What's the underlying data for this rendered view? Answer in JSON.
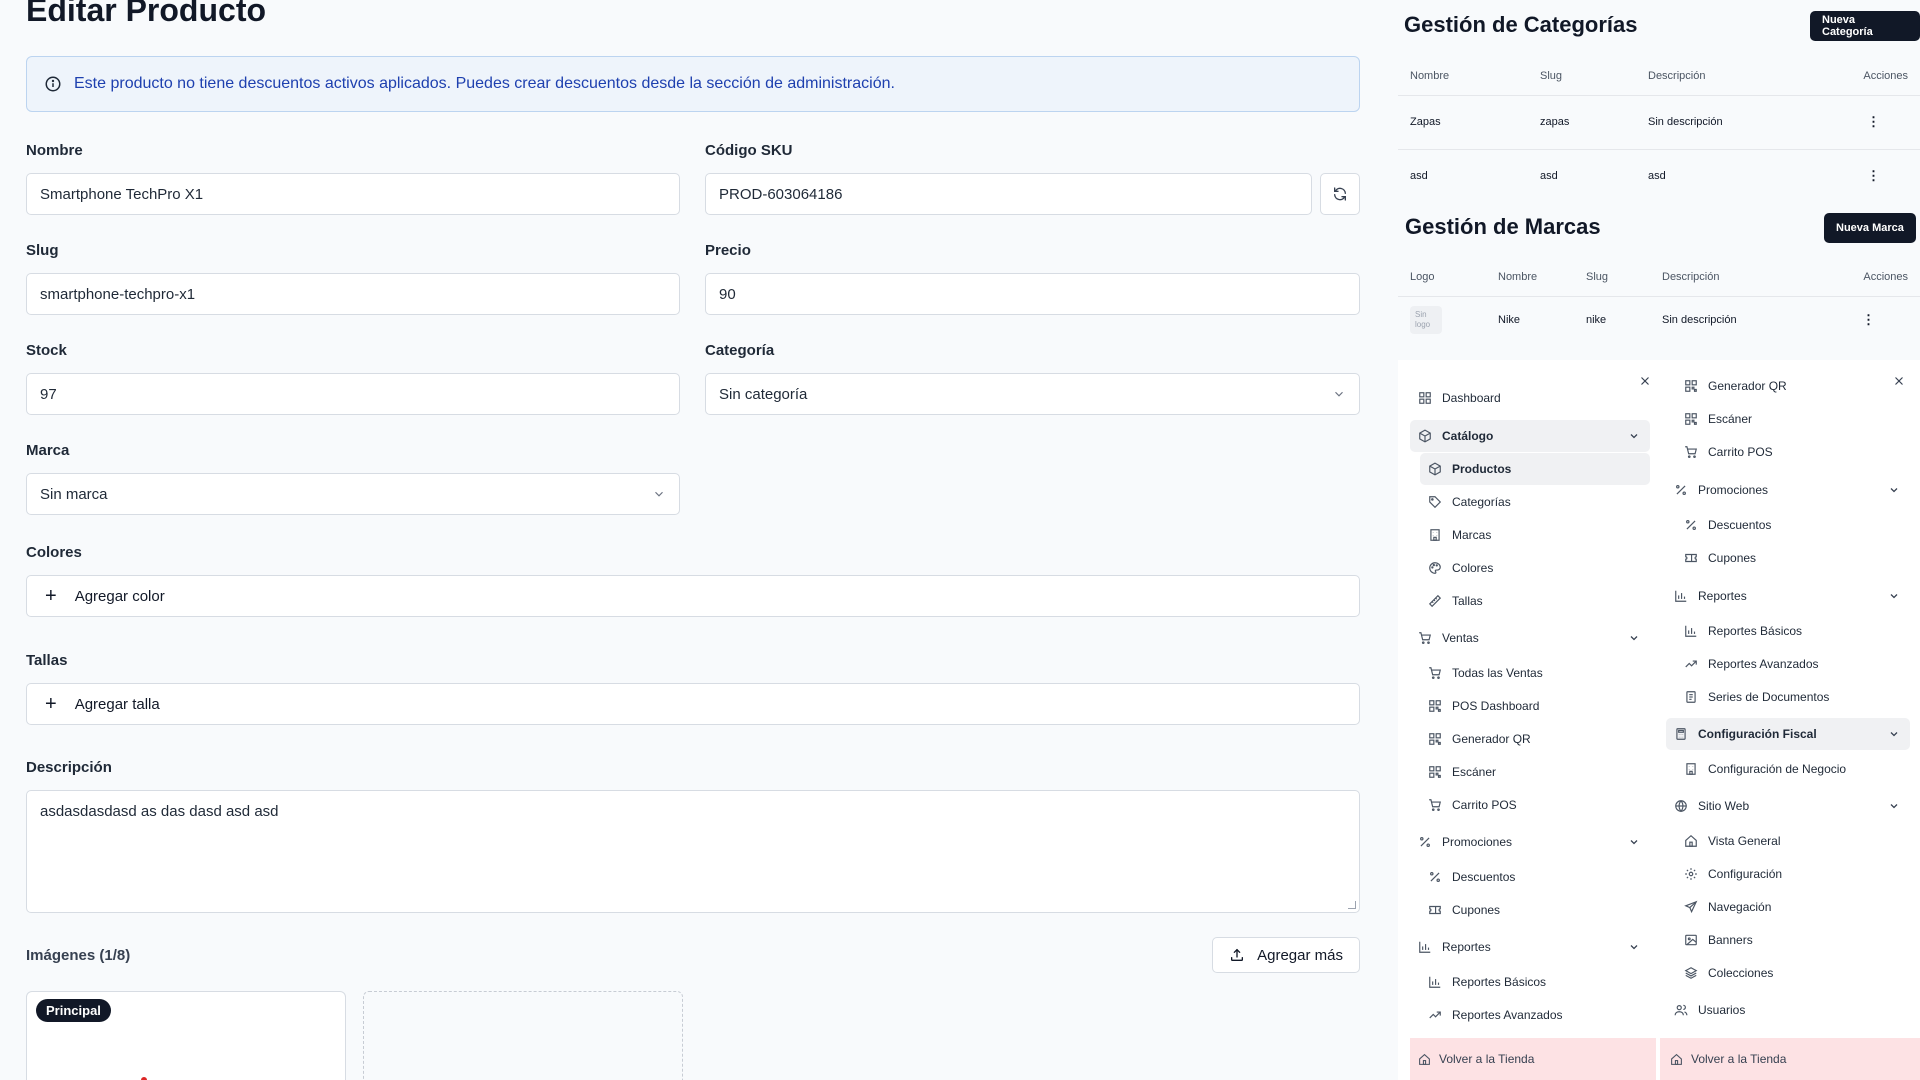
{
  "form": {
    "title": "Editar Producto",
    "alert": "Este producto no tiene descuentos activos aplicados. Puedes crear descuentos desde la sección de administración.",
    "nombre": {
      "label": "Nombre",
      "value": "Smartphone TechPro X1"
    },
    "sku": {
      "label": "Código SKU",
      "value": "PROD-603064186"
    },
    "slug": {
      "label": "Slug",
      "value": "smartphone-techpro-x1"
    },
    "precio": {
      "label": "Precio",
      "value": "90"
    },
    "stock": {
      "label": "Stock",
      "value": "97"
    },
    "categoria": {
      "label": "Categoría",
      "value": "Sin categoría"
    },
    "marca": {
      "label": "Marca",
      "value": "Sin marca"
    },
    "colores": {
      "label": "Colores",
      "add": "Agregar color"
    },
    "tallas": {
      "label": "Tallas",
      "add": "Agregar talla"
    },
    "descripcion": {
      "label": "Descripción",
      "value": "asdasdasdasd as das dasd asd asd"
    },
    "imagenes": {
      "label": "Imágenes (1/8)",
      "add": "Agregar más",
      "badge": "Principal"
    }
  },
  "categorias": {
    "title": "Gestión de Categorías",
    "new_button": "Nueva Categoría",
    "headers": [
      "Nombre",
      "Slug",
      "Descripción",
      "Acciones"
    ],
    "rows": [
      {
        "nombre": "Zapas",
        "slug": "zapas",
        "descripcion": "Sin descripción",
        "acciones": "⋮"
      },
      {
        "nombre": "asd",
        "slug": "asd",
        "descripcion": "asd",
        "acciones": "⋮"
      }
    ]
  },
  "marcas": {
    "title": "Gestión de Marcas",
    "new_button": "Nueva Marca",
    "headers": [
      "Logo",
      "Nombre",
      "Slug",
      "Descripción",
      "Acciones"
    ],
    "rows": [
      {
        "logo": "Sin logo",
        "nombre": "Nike",
        "slug": "nike",
        "descripcion": "Sin descripción",
        "acciones": "⋮"
      }
    ]
  },
  "menu_a": {
    "items": [
      {
        "label": "Dashboard",
        "icon": "dashboard-icon"
      },
      {
        "label": "Catálogo",
        "icon": "box-icon"
      },
      {
        "label": "Productos",
        "icon": "box-icon"
      },
      {
        "label": "Categorías",
        "icon": "tag-icon"
      },
      {
        "label": "Marcas",
        "icon": "building-icon"
      },
      {
        "label": "Colores",
        "icon": "palette-icon"
      },
      {
        "label": "Tallas",
        "icon": "ruler-icon"
      },
      {
        "label": "Ventas",
        "icon": "cart-icon"
      },
      {
        "label": "Todas las Ventas",
        "icon": "cart-icon"
      },
      {
        "label": "POS Dashboard",
        "icon": "qr-icon"
      },
      {
        "label": "Generador QR",
        "icon": "qr-icon"
      },
      {
        "label": "Escáner",
        "icon": "qr-icon"
      },
      {
        "label": "Carrito POS",
        "icon": "cart-icon"
      },
      {
        "label": "Promociones",
        "icon": "percent-icon"
      },
      {
        "label": "Descuentos",
        "icon": "percent-icon"
      },
      {
        "label": "Cupones",
        "icon": "ticket-icon"
      },
      {
        "label": "Reportes",
        "icon": "bar-chart-icon"
      },
      {
        "label": "Reportes Básicos",
        "icon": "bar-chart-icon"
      },
      {
        "label": "Reportes Avanzados",
        "icon": "trend-icon"
      }
    ],
    "back": "Volver a la Tienda"
  },
  "menu_b": {
    "items": [
      {
        "label": "Generador QR",
        "icon": "qr-icon"
      },
      {
        "label": "Escáner",
        "icon": "qr-icon"
      },
      {
        "label": "Carrito POS",
        "icon": "cart-icon"
      },
      {
        "label": "Promociones",
        "icon": "percent-icon"
      },
      {
        "label": "Descuentos",
        "icon": "percent-icon"
      },
      {
        "label": "Cupones",
        "icon": "ticket-icon"
      },
      {
        "label": "Reportes",
        "icon": "bar-chart-icon"
      },
      {
        "label": "Reportes Básicos",
        "icon": "bar-chart-icon"
      },
      {
        "label": "Reportes Avanzados",
        "icon": "trend-icon"
      },
      {
        "label": "Series de Documentos",
        "icon": "document-icon"
      },
      {
        "label": "Configuración Fiscal",
        "icon": "calculator-icon"
      },
      {
        "label": "Configuración de Negocio",
        "icon": "building-icon"
      },
      {
        "label": "Sitio Web",
        "icon": "globe-icon"
      },
      {
        "label": "Vista General",
        "icon": "home-icon"
      },
      {
        "label": "Configuración",
        "icon": "gear-icon"
      },
      {
        "label": "Navegación",
        "icon": "send-icon"
      },
      {
        "label": "Banners",
        "icon": "image-icon"
      },
      {
        "label": "Colecciones",
        "icon": "layers-icon"
      },
      {
        "label": "Usuarios",
        "icon": "users-icon"
      }
    ],
    "back": "Volver a la Tienda"
  }
}
